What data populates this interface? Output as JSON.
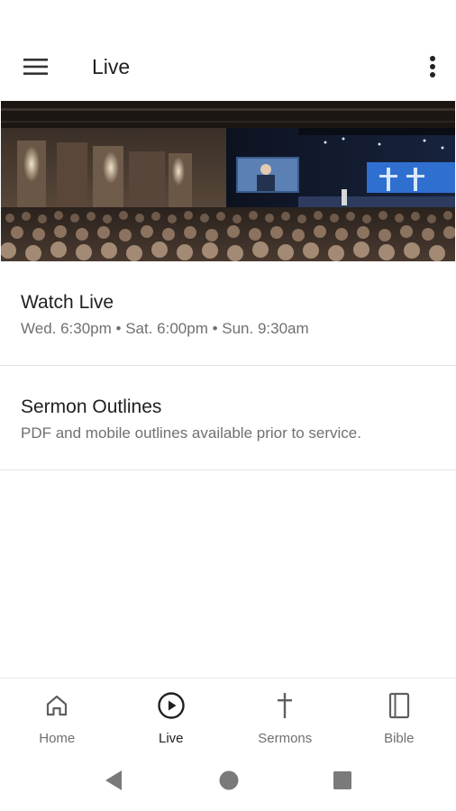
{
  "app_bar": {
    "title": "Live",
    "menu_icon": "hamburger-menu-icon",
    "more_icon": "more-vertical-icon"
  },
  "hero": {
    "image": "church-auditorium-live-service-photo"
  },
  "list": [
    {
      "title": "Watch Live",
      "subtitle": "Wed. 6:30pm • Sat. 6:00pm • Sun. 9:30am"
    },
    {
      "title": "Sermon Outlines",
      "subtitle": "PDF and mobile outlines available prior to service."
    }
  ],
  "bottom_nav": [
    {
      "label": "Home",
      "icon": "home-icon",
      "active": false
    },
    {
      "label": "Live",
      "icon": "play-circle-icon",
      "active": true
    },
    {
      "label": "Sermons",
      "icon": "cross-icon",
      "active": false
    },
    {
      "label": "Bible",
      "icon": "book-icon",
      "active": false
    }
  ],
  "system_nav": {
    "back_icon": "back-triangle-icon",
    "home_icon": "home-circle-icon",
    "recents_icon": "recents-square-icon"
  },
  "colors": {
    "background": "#ffffff",
    "text_primary": "#1f1f1f",
    "text_secondary": "#707070",
    "divider": "#e6e6e6",
    "nav_inactive": "#6f6f6f",
    "nav_active": "#202020"
  }
}
